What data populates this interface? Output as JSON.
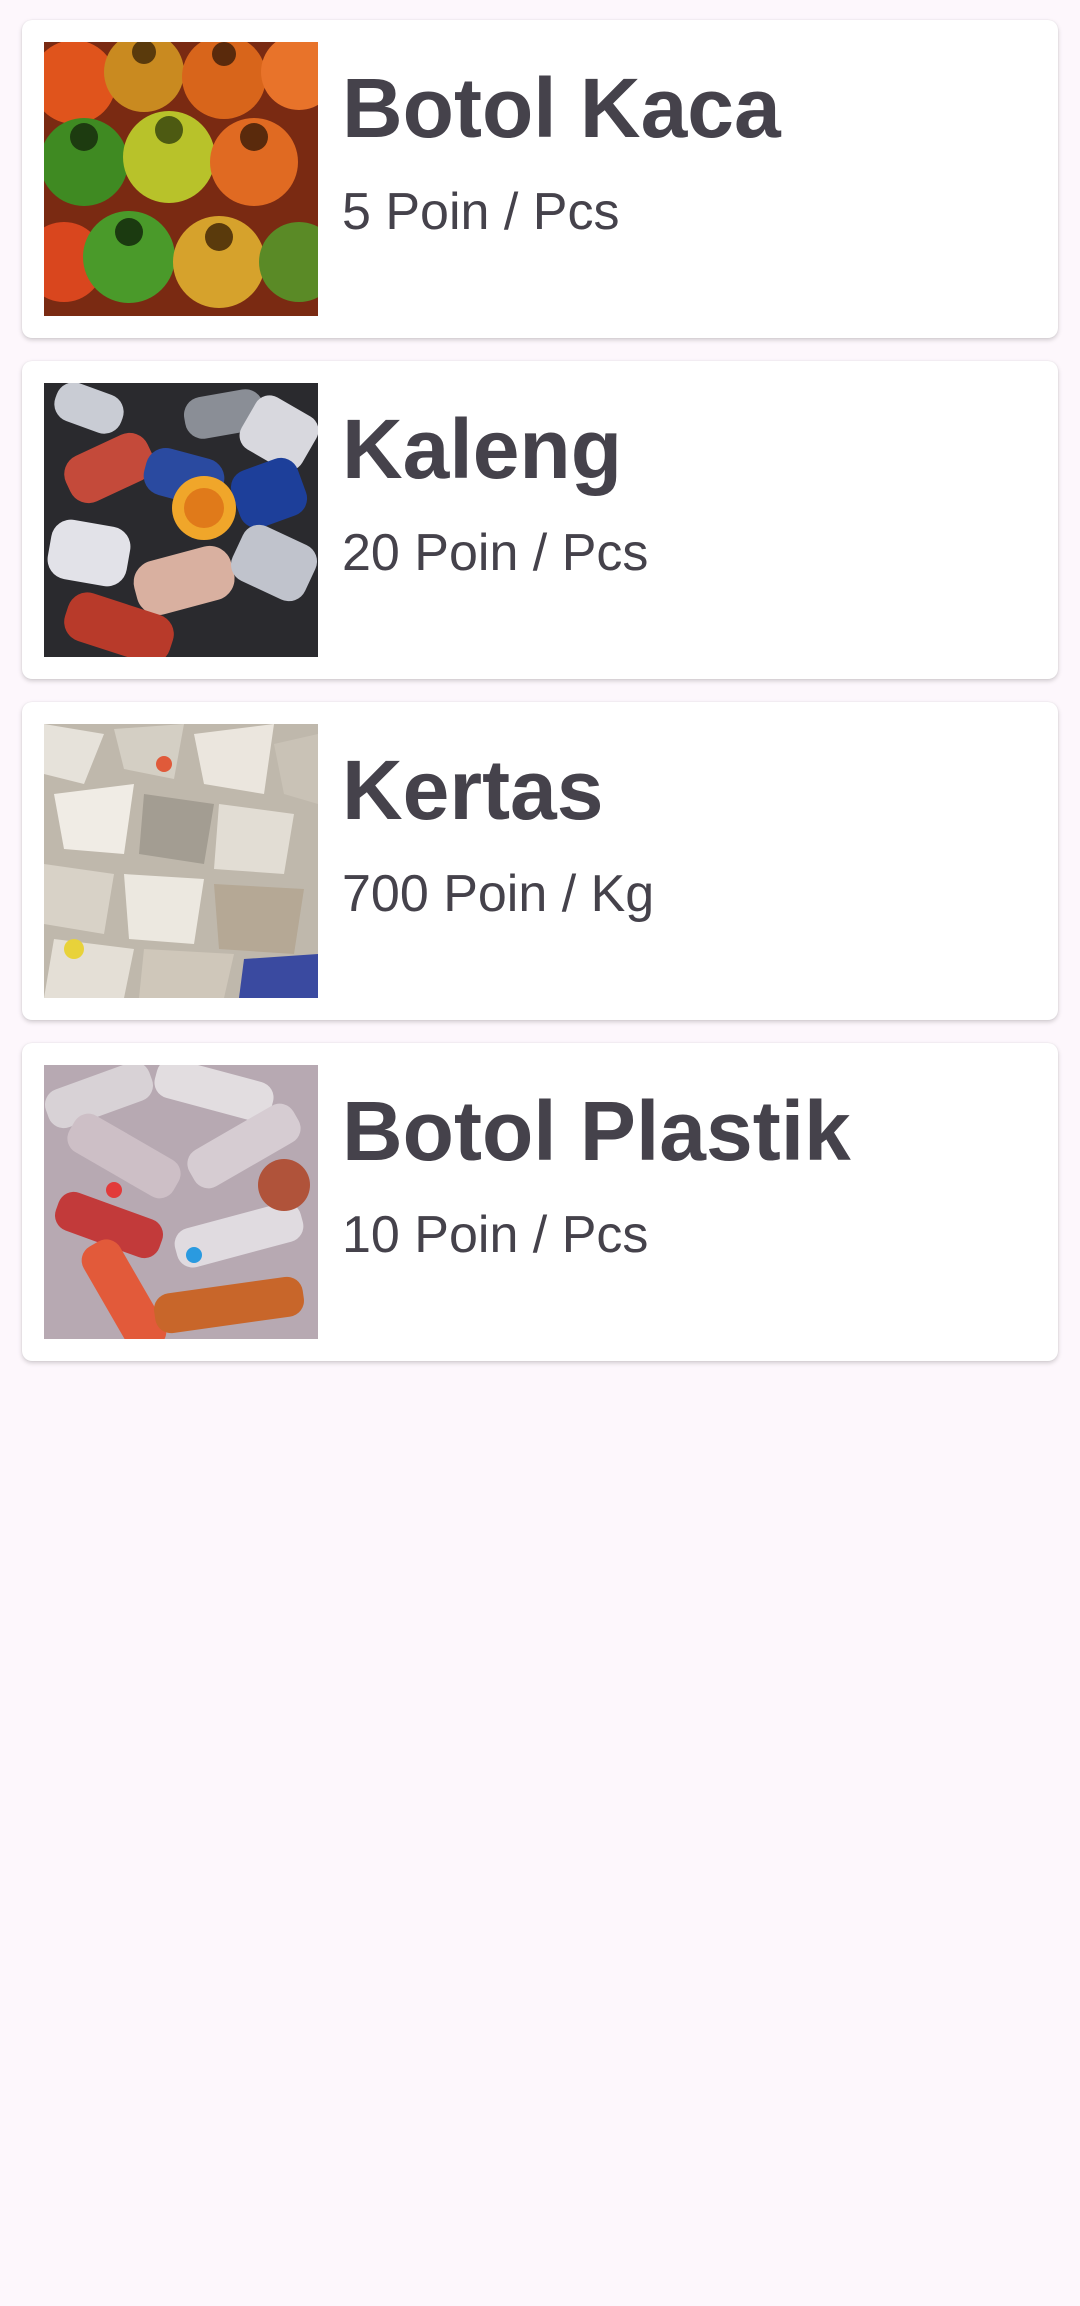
{
  "items": [
    {
      "title": "Botol Kaca",
      "points": "5 Poin / Pcs",
      "image": "glass-bottles-photo"
    },
    {
      "title": "Kaleng",
      "points": "20 Poin / Pcs",
      "image": "cans-photo"
    },
    {
      "title": "Kertas",
      "points": "700 Poin / Kg",
      "image": "paper-photo"
    },
    {
      "title": "Botol Plastik",
      "points": "10 Poin / Pcs",
      "image": "plastic-bottles-photo"
    }
  ]
}
